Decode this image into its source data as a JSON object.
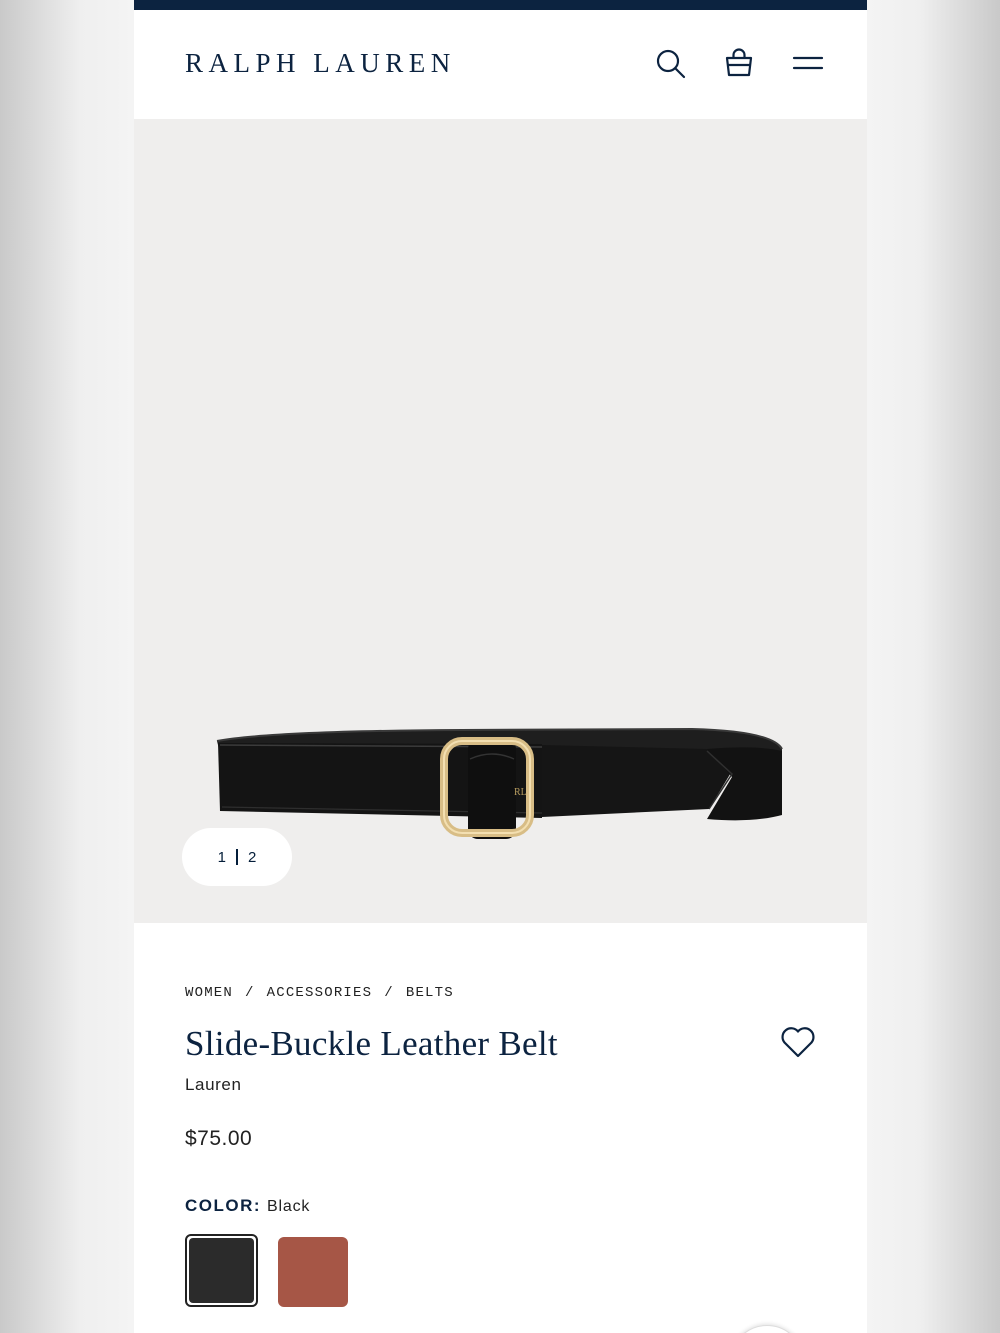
{
  "header": {
    "logo": "RALPH LAUREN",
    "icons": {
      "search": "search-icon",
      "bag": "shopping-bag-icon",
      "menu": "menu-icon"
    }
  },
  "gallery": {
    "image_alt": "Slide-Buckle Leather Belt",
    "current": "1",
    "total": "2"
  },
  "breadcrumb": [
    "WOMEN",
    "ACCESSORIES",
    "BELTS"
  ],
  "product": {
    "name": "Slide-Buckle Leather Belt",
    "brand": "Lauren",
    "price": "$75.00",
    "color_label": "COLOR:",
    "color_value": "Black",
    "wishlist_icon": "heart-icon",
    "swatches": [
      {
        "name": "Black",
        "hex": "#2b2b2b",
        "selected": true
      },
      {
        "hex": "#a65646",
        "selected": false
      }
    ]
  },
  "colors": {
    "navy": "#0c2340",
    "hero_bg": "#efeeed",
    "text": "#222222"
  }
}
